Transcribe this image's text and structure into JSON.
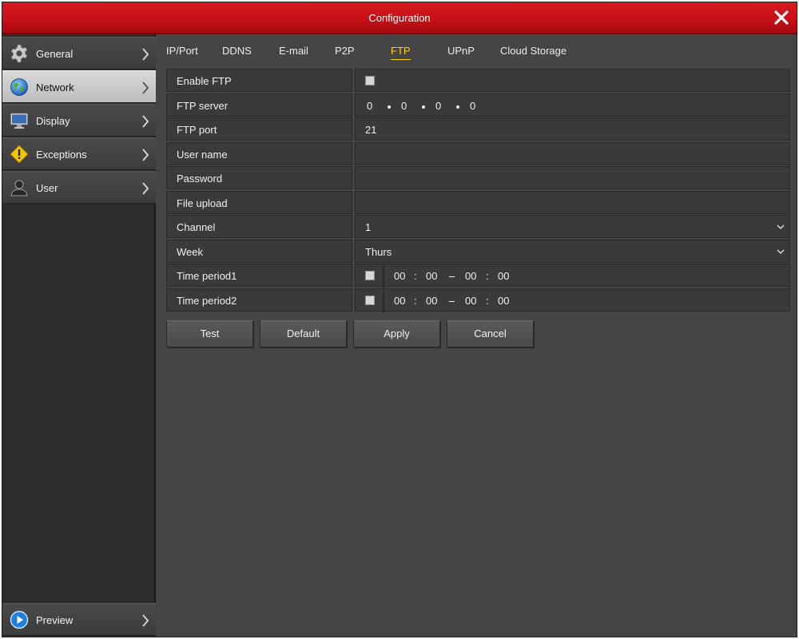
{
  "window": {
    "title": "Configuration"
  },
  "sidebar": {
    "items": [
      {
        "label": "General",
        "icon": "gear-icon"
      },
      {
        "label": "Network",
        "icon": "globe-icon",
        "active": true
      },
      {
        "label": "Display",
        "icon": "monitor-icon"
      },
      {
        "label": "Exceptions",
        "icon": "warning-icon"
      },
      {
        "label": "User",
        "icon": "user-icon"
      }
    ],
    "preview": {
      "label": "Preview",
      "icon": "play-icon"
    }
  },
  "tabs": [
    {
      "label": "IP/Port"
    },
    {
      "label": "DDNS"
    },
    {
      "label": "E-mail"
    },
    {
      "label": "P2P"
    },
    {
      "label": "FTP",
      "active": true
    },
    {
      "label": "UPnP"
    },
    {
      "label": "Cloud Storage"
    }
  ],
  "form": {
    "enable_ftp": {
      "label": "Enable FTP",
      "checked": false
    },
    "ftp_server": {
      "label": "FTP server",
      "ip": [
        "0",
        "0",
        "0",
        "0"
      ]
    },
    "ftp_port": {
      "label": "FTP port",
      "value": "21"
    },
    "user_name": {
      "label": "User name",
      "value": ""
    },
    "password": {
      "label": "Password",
      "value": ""
    },
    "file_upload": {
      "label": "File upload",
      "value": ""
    },
    "channel": {
      "label": "Channel",
      "value": "1"
    },
    "week": {
      "label": "Week",
      "value": "Thurs"
    },
    "time_period1": {
      "label": "Time period1",
      "checked": false,
      "start_h": "00",
      "start_m": "00",
      "end_h": "00",
      "end_m": "00",
      "colon": ":"
    },
    "time_period2": {
      "label": "Time period2",
      "checked": false,
      "start_h": "00",
      "start_m": "00",
      "end_h": "00",
      "end_m": "00",
      "colon": ":"
    }
  },
  "buttons": {
    "test": "Test",
    "default": "Default",
    "apply": "Apply",
    "cancel": "Cancel"
  },
  "colors": {
    "title_bar": "#c70f16",
    "active_tab": "#ffd400",
    "panel": "#454545",
    "sidebar": "#2c2c2c"
  }
}
